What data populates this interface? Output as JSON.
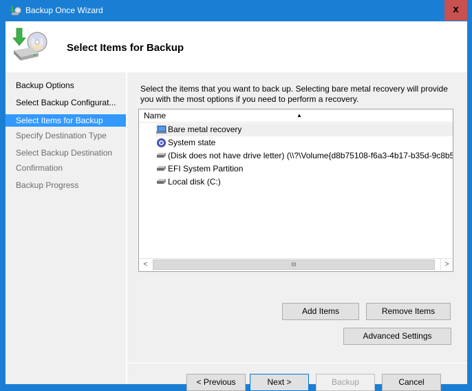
{
  "window": {
    "title": "Backup Once Wizard",
    "close_label": "x"
  },
  "header": {
    "title": "Select Items for Backup"
  },
  "sidebar": {
    "items": [
      {
        "label": "Backup Options",
        "state": "done"
      },
      {
        "label": "Select Backup Configurat...",
        "state": "done"
      },
      {
        "label": "Select Items for Backup",
        "state": "active"
      },
      {
        "label": "Specify Destination Type",
        "state": "pending"
      },
      {
        "label": "Select Backup Destination",
        "state": "pending"
      },
      {
        "label": "Confirmation",
        "state": "pending"
      },
      {
        "label": "Backup Progress",
        "state": "pending"
      }
    ]
  },
  "main": {
    "description": "Select the items that you want to back up. Selecting bare metal recovery will provide you with the most options if you need to perform a recovery.",
    "list": {
      "column_header": "Name",
      "sort_indicator": "▲",
      "items": [
        {
          "icon": "bare-metal-recovery-icon",
          "label": "Bare metal recovery",
          "selected": true
        },
        {
          "icon": "system-state-icon",
          "label": "System state",
          "selected": false
        },
        {
          "icon": "disk-icon",
          "label": "(Disk does not have drive letter) (\\\\?\\Volume{d8b75108-f6a3-4b17-b35d-9c8b5...",
          "selected": false
        },
        {
          "icon": "disk-icon",
          "label": "EFI System Partition",
          "selected": false
        },
        {
          "icon": "disk-icon",
          "label": "Local disk (C:)",
          "selected": false
        }
      ],
      "scroll_left": "<",
      "scroll_right": ">",
      "scroll_thumb": "III"
    },
    "buttons": {
      "add_items": "Add Items",
      "remove_items": "Remove Items",
      "advanced_settings": "Advanced Settings"
    }
  },
  "footer": {
    "previous": "< Previous",
    "next": "Next >",
    "backup": "Backup",
    "cancel": "Cancel"
  },
  "colors": {
    "frame": "#1a7fd4",
    "close": "#c75050",
    "active_step": "#3399ff"
  }
}
